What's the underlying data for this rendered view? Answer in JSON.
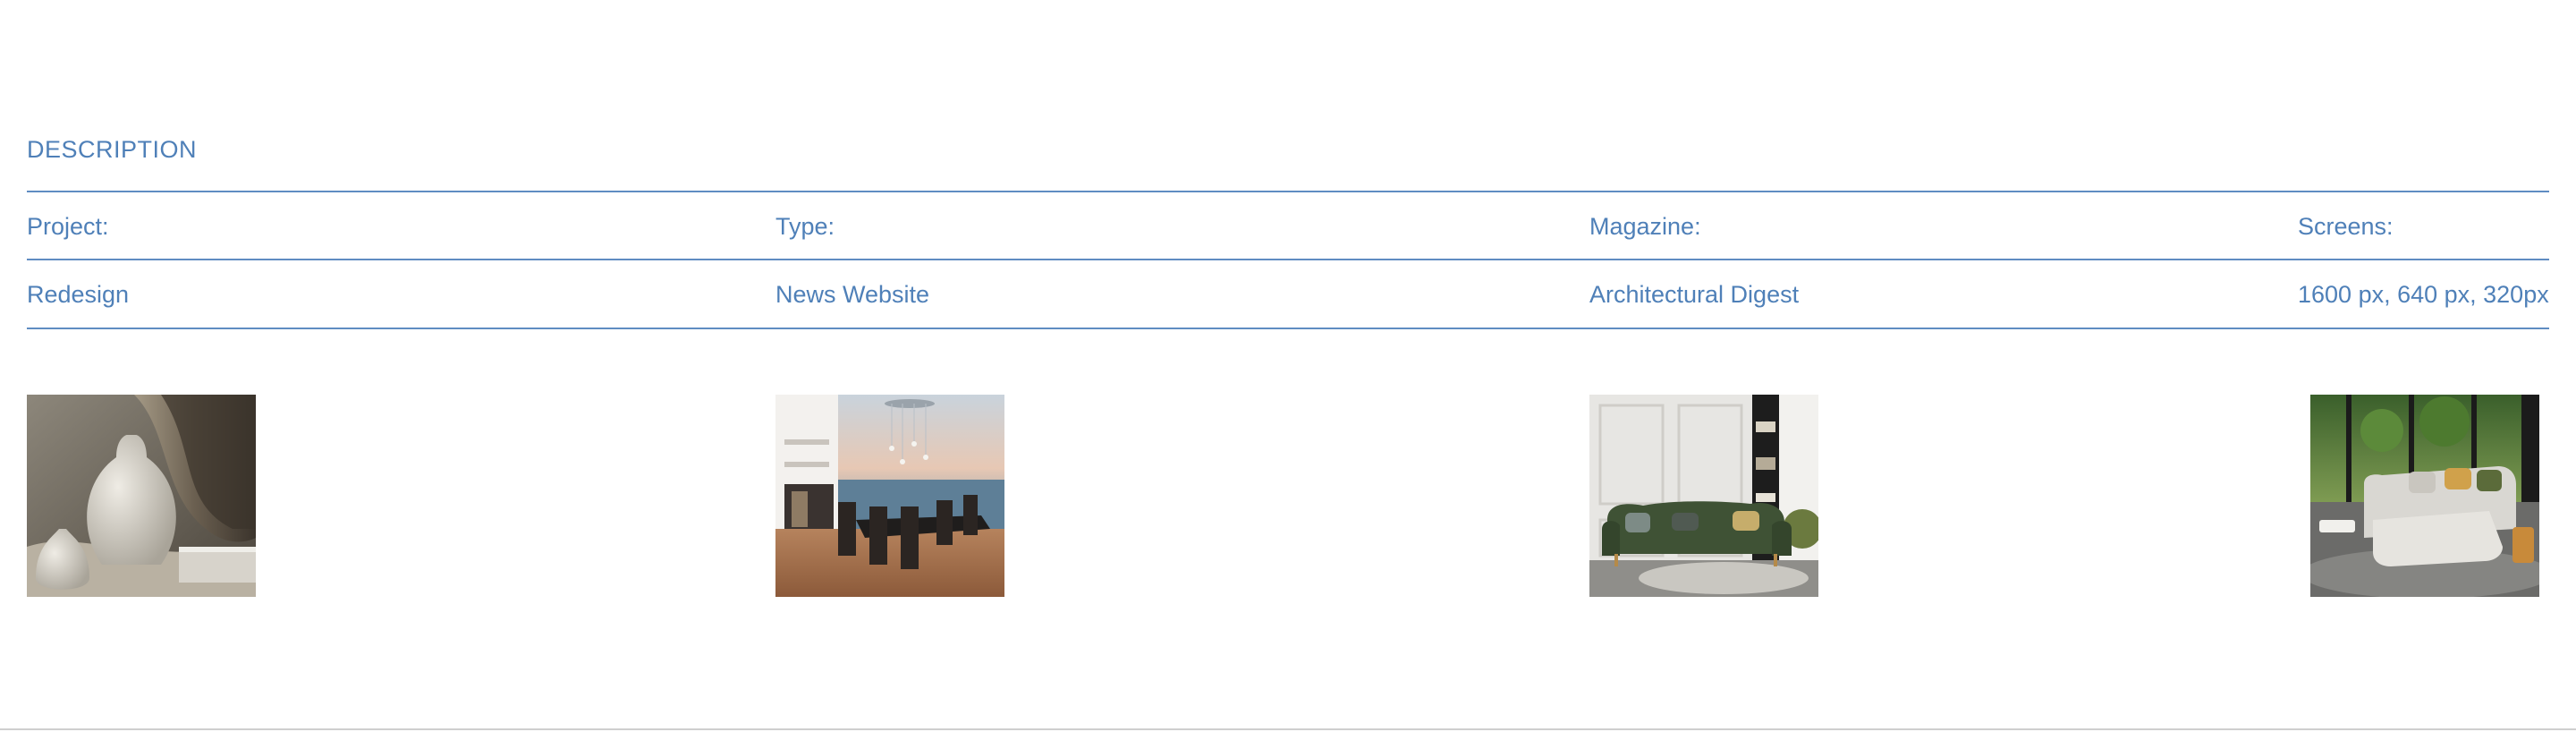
{
  "section": {
    "title": "DESCRIPTION"
  },
  "table": {
    "headers": [
      "Project:",
      "Type:",
      "Magazine:",
      "Screens:"
    ],
    "values": [
      "Redesign",
      "News Website",
      "Architectural Digest",
      "1600 px, 640 px, 320px"
    ]
  },
  "gallery": {
    "images": [
      {
        "name": "vases-image"
      },
      {
        "name": "dining-room-sea-view-image"
      },
      {
        "name": "green-sofa-panel-wall-image"
      },
      {
        "name": "white-sectional-sofa-image"
      }
    ]
  },
  "colors": {
    "text": "#4f80b8",
    "rule": "#5f8cc2",
    "background": "#ffffff"
  }
}
